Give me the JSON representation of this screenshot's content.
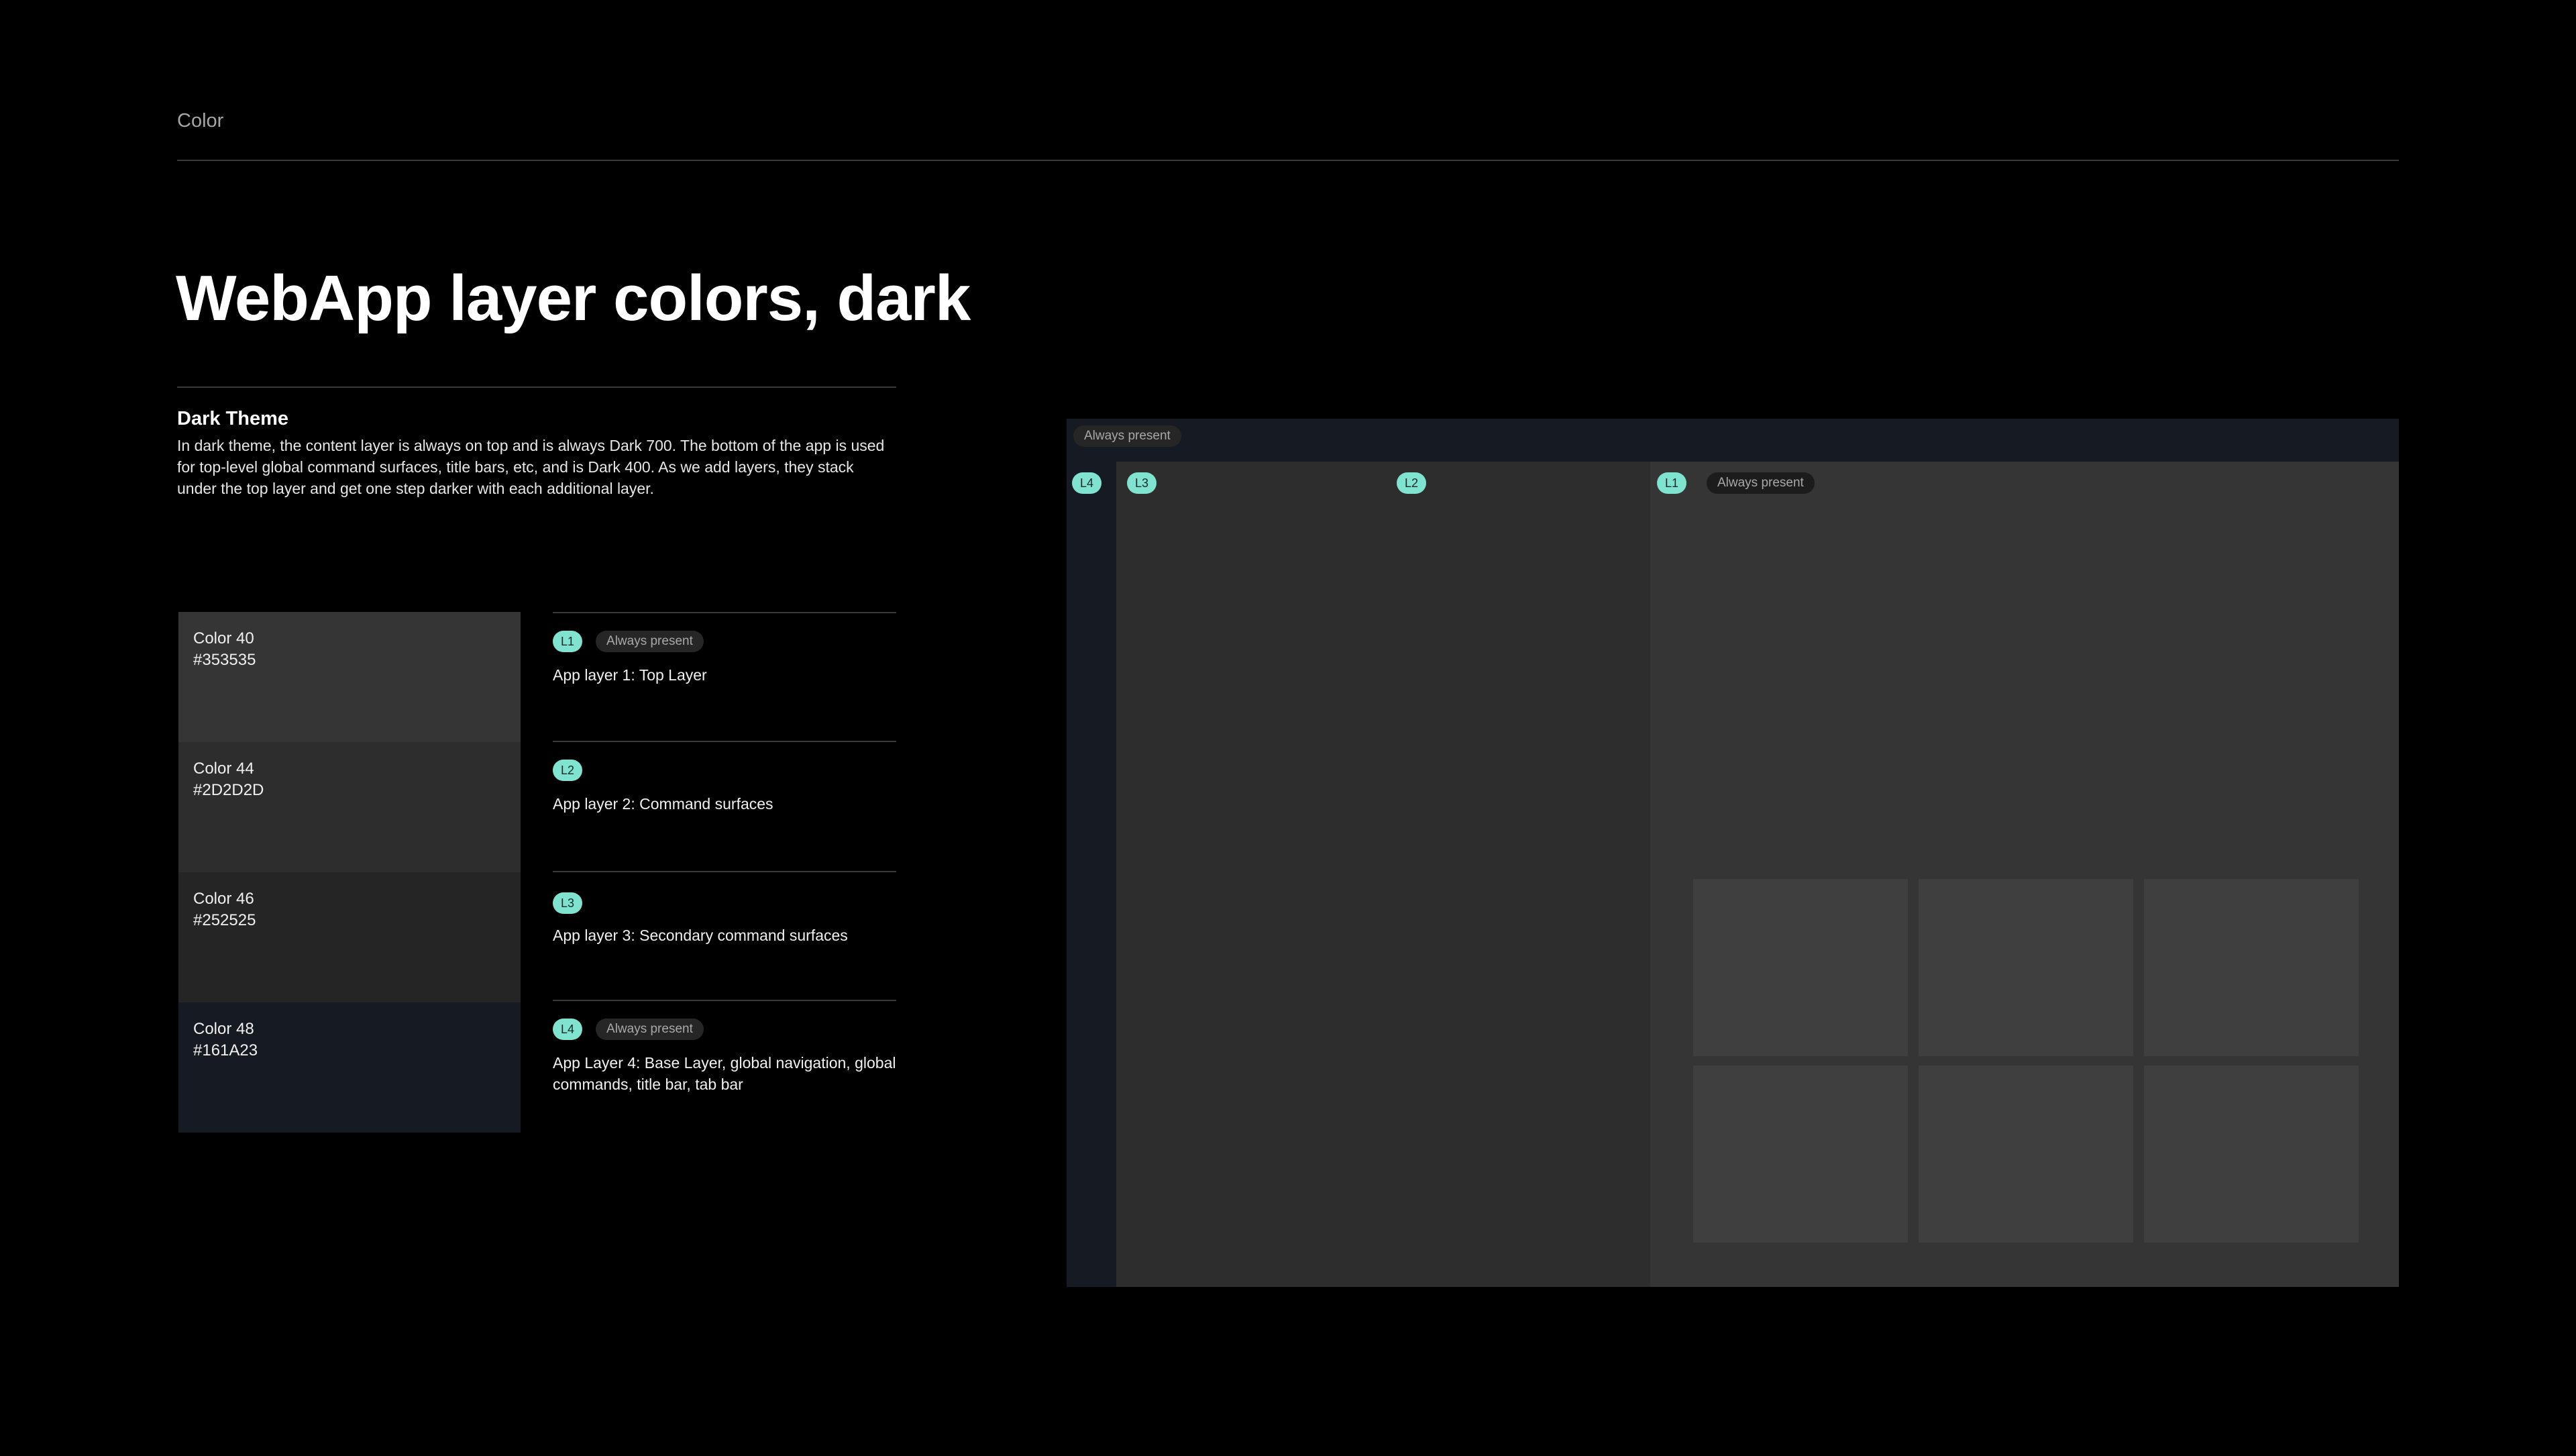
{
  "section_label": "Color",
  "title": "WebApp layer colors, dark",
  "theme": {
    "heading": "Dark Theme",
    "description": "In dark theme, the content layer is always on top and is always Dark 700.  The bottom of the app is used for top-level global command surfaces, title bars, etc, and is Dark 400. As we add layers, they stack under the top layer and get one step darker with each additional layer."
  },
  "swatches": [
    {
      "name": "Color 40",
      "hex": "#353535"
    },
    {
      "name": "Color 44",
      "hex": "#2D2D2D"
    },
    {
      "name": "Color 46",
      "hex": "#252525"
    },
    {
      "name": "Color 48",
      "hex": "#161A23"
    }
  ],
  "layers": [
    {
      "badge": "L1",
      "pill": "Always present",
      "description": "App layer 1: Top Layer"
    },
    {
      "badge": "L2",
      "description": "App layer 2: Command surfaces"
    },
    {
      "badge": "L3",
      "description": "App layer 3: Secondary command surfaces"
    },
    {
      "badge": "L4",
      "pill": "Always present",
      "description": "App Layer 4: Base Layer, global navigation, global commands, title bar, tab bar"
    }
  ],
  "mockup": {
    "header_pill": "Always present",
    "badges": {
      "l4": "L4",
      "l3": "L3",
      "l2": "L2",
      "l1": "L1"
    },
    "l1_pill": "Always present"
  },
  "colors": {
    "accent": "#7FE3D0",
    "background": "#000000",
    "card": "#3F3F3F"
  }
}
